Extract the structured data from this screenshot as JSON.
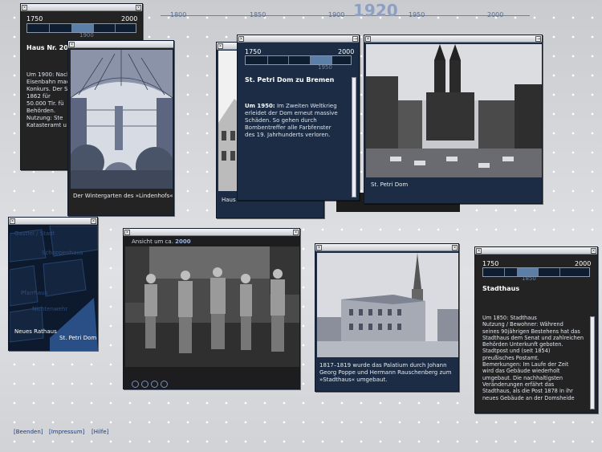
{
  "timeline": {
    "current_year": "1920",
    "ticks": [
      "1800",
      "1850",
      "1900",
      "1950",
      "2000"
    ]
  },
  "win_haus20": {
    "range_start": "1750",
    "range_end": "2000",
    "selected": "1900",
    "title": "Haus Nr. 20",
    "lines": [
      "Um 1900: Nach der",
      "Eisenbahn machte",
      "Konkurs. Der S",
      "1862 für",
      "50.000 Tlr. fü",
      "Behörden.",
      "Nutzung: Ste",
      "Katasteramt u"
    ]
  },
  "win_winter": {
    "caption": "Der Wintergarten des »Lindenhofs«"
  },
  "win_haus_small": {
    "caption": "Haus"
  },
  "win_dom": {
    "range_start": "1750",
    "range_end": "2000",
    "selected": "1950",
    "title": "St. Petri Dom zu Bremen",
    "text_label": "Um 1950:",
    "text": "Im Zweiten Weltkrieg erleidet der Dom erneut massive Schäden. So gehen durch Bombentreffer alle Farbfenster des 19. Jahrhunderts verloren."
  },
  "win_dom_photo": {
    "caption": "St. Petri Dom"
  },
  "win_map": {
    "labels": [
      "Neues Rathaus",
      "St. Petri Dom",
      "Gastfel / Stadt",
      "Pfarrhaus",
      "Nichtenwehr",
      "Schoppenhaus"
    ]
  },
  "win_group": {
    "caption_prefix": "Ansicht um ca. ",
    "caption_year": "2000"
  },
  "win_palatium": {
    "caption": "1817–1819 wurde das Palatium durch Johann Georg Poppe und Hermann Rauschenberg zum »Stadthaus« umgebaut."
  },
  "win_stadthaus": {
    "range_start": "1750",
    "range_end": "2000",
    "selected": "1850",
    "title": "Stadthaus",
    "l1": "Um 1850: Stadthaus",
    "l2": "Nutzung / Bewohner: Während",
    "l3": "seines 90jährigen Bestehens hat das",
    "l4": "Stadthaus dem Senat und zahlreichen",
    "l5": "Behörden Unterkunft geboten.",
    "l6": "Stadtpost und (seit 1854)",
    "l7": "preußisches Postamt.",
    "l8": "Bemerkungen: Im Laufe der Zeit",
    "l9": "wird das Gebäude wiederholt",
    "l10": "umgebaut. Die nachhaltigsten",
    "l11": "Veränderungen erfährt das",
    "l12": "Stadthaus, als die Post 1878 in ihr",
    "l13": "neues Gebäude an der Domsheide"
  },
  "footer": {
    "quit": "[Beenden]",
    "impressum": "[Impressum]",
    "help": "[Hilfe]"
  }
}
